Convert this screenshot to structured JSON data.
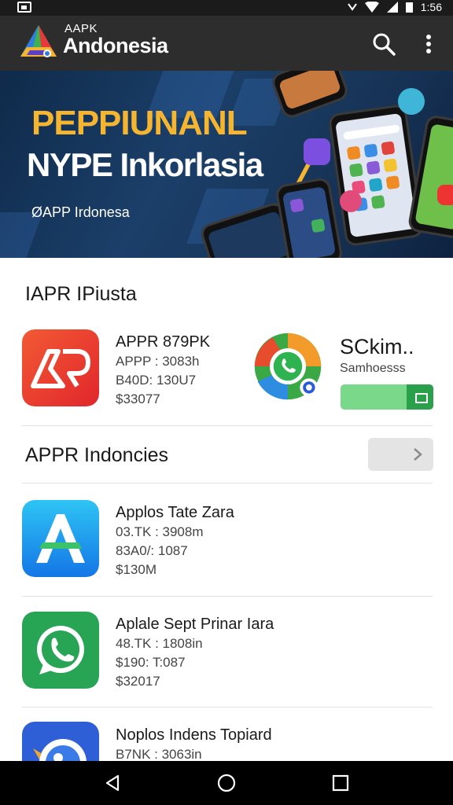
{
  "status_bar": {
    "time": "1:56",
    "icons": [
      "image-icon",
      "wifi-icon",
      "signal-icon",
      "battery-icon"
    ]
  },
  "app_bar": {
    "title_small": "AAPK",
    "title_big": "Andonesia",
    "actions": [
      "search-icon",
      "more-vert-icon"
    ]
  },
  "banner": {
    "line1": "PEPPIUNANL",
    "line2": "NYPE Inkorlasia",
    "line3": "ØAPP Irdonesa"
  },
  "section1": {
    "title": "IAPR IPiusta",
    "apps": [
      {
        "name": "APPR 879PK",
        "meta1": "APPP : 3083h",
        "meta2": "B40D: 130U7",
        "meta3": "$33077",
        "icon": "ap-logo-icon"
      },
      {
        "name": "SCkim..",
        "sub": "Samhoesss",
        "icon": "whatsapp-icon"
      }
    ]
  },
  "section2": {
    "title": "APPR Indoncies",
    "apps": [
      {
        "name": "Applos Tate Zara",
        "meta1": "03.TK : 3908m",
        "meta2": "83A0/: 1087",
        "meta3": "$130M",
        "icon": "app-store-icon"
      },
      {
        "name": "Aplale Sept Prinar Iara",
        "meta1": "48.TK : 1808in",
        "meta2": "$190: T:087",
        "meta3": "$32017",
        "icon": "whatsapp-icon"
      },
      {
        "name": "Noplos Indens Topiard",
        "meta1": "B7NK : 3063in",
        "icon": "bird-icon"
      }
    ]
  },
  "nav_bar": {
    "buttons": [
      "back-icon",
      "home-icon",
      "recents-icon"
    ]
  },
  "colors": {
    "app_bar": "#2d2d2d",
    "banner_bg": "#173457",
    "banner_accent": "#f5b531",
    "install_green": "#79d889",
    "install_green_dark": "#2aa04a"
  }
}
